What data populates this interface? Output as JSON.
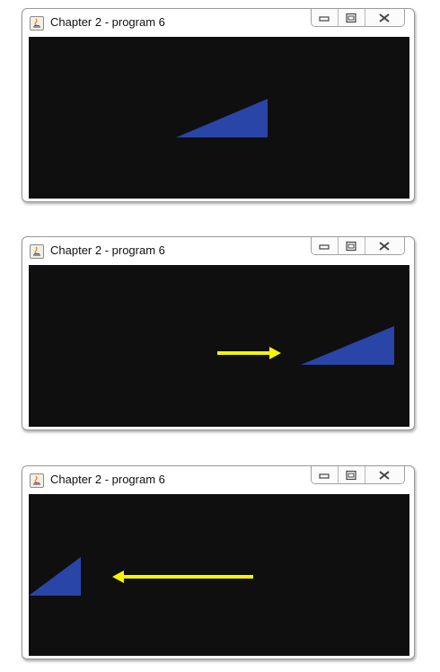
{
  "frames": [
    {
      "title": "Chapter 2 - program 6",
      "icons": {
        "app": "java-icon",
        "minimize": "minimize-icon",
        "maximize": "maximize-icon",
        "close": "close-icon"
      },
      "triangle_color": "#2a45a8"
    },
    {
      "title": "Chapter 2 - program 6",
      "icons": {
        "app": "java-icon",
        "minimize": "minimize-icon",
        "maximize": "maximize-icon",
        "close": "close-icon"
      },
      "triangle_color": "#2a45a8",
      "arrow": {
        "direction": "right",
        "color": "#f5f500",
        "icon": "arrow-right-icon"
      }
    },
    {
      "title": "Chapter 2 - program 6",
      "icons": {
        "app": "java-icon",
        "minimize": "minimize-icon",
        "maximize": "maximize-icon",
        "close": "close-icon"
      },
      "triangle_color": "#2a45a8",
      "arrow": {
        "direction": "left",
        "color": "#f5f500",
        "icon": "arrow-left-icon"
      }
    }
  ],
  "colors": {
    "canvas_background": "#0f0f0f",
    "window_border": "#9a9a9a"
  }
}
